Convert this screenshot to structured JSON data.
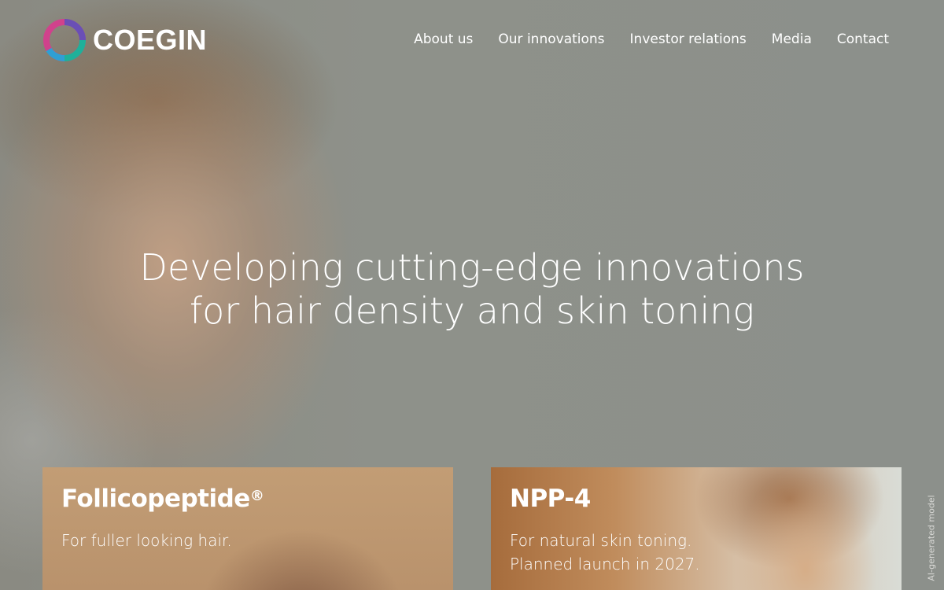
{
  "brand": {
    "name": "COEGIN"
  },
  "nav": {
    "items": [
      {
        "label": "About us"
      },
      {
        "label": "Our innovations"
      },
      {
        "label": "Investor relations"
      },
      {
        "label": "Media"
      },
      {
        "label": "Contact"
      }
    ]
  },
  "hero": {
    "headline_line1": "Developing cutting-edge innovations",
    "headline_line2": "for hair density and skin toning",
    "side_note": "AI-generated model"
  },
  "cards": [
    {
      "title": "Follicopeptide",
      "title_mark": "®",
      "text_line1": "For fuller looking hair.",
      "text_line2": ""
    },
    {
      "title": "NPP-4",
      "title_mark": "",
      "text_line1": "For natural skin toning.",
      "text_line2": "Planned launch in 2027."
    }
  ],
  "colors": {
    "logo_ring_magenta": "#d0428c",
    "logo_ring_teal": "#1fb09a",
    "logo_ring_purple": "#6a4fb6",
    "text": "#ffffff"
  }
}
